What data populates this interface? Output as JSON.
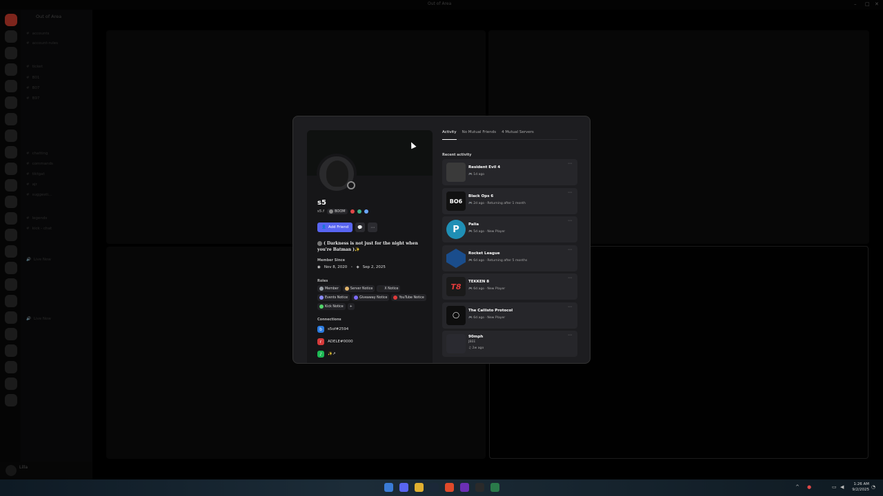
{
  "window": {
    "title": "Out of Area"
  },
  "server": {
    "name": "Out of Area"
  },
  "channels": [
    "accounts",
    "account-rules",
    "ticket",
    "B01",
    "B07",
    "B97",
    "chatting",
    "commands",
    "tiktgat",
    "ajr",
    "suggesti...",
    "legends",
    "kick - chat",
    "Live Now",
    "Live Now"
  ],
  "user_panel": {
    "name": "Lilla"
  },
  "profile": {
    "display_name": "s5",
    "username": "s5.f",
    "guild_tag": "BOOM",
    "add_friend_label": "Add Friend",
    "bio": "( Darkness is not just for the night when you're Batman )✨",
    "member_since_label": "Member Since",
    "member_since_discord": "Nov 8, 2020",
    "member_since_server": "Sep 2, 2025",
    "roles_label": "Roles",
    "roles": [
      {
        "name": "Member",
        "color": "#9aa0a6"
      },
      {
        "name": "Server Notice",
        "color": "#e0b36a"
      },
      {
        "name": "X Notice",
        "color": "#222222"
      },
      {
        "name": "Events Notice",
        "color": "#8b8bff"
      },
      {
        "name": "Giveaway Notice",
        "color": "#7d6bff"
      },
      {
        "name": "YouTube Notice",
        "color": "#e03b3b"
      },
      {
        "name": "Kick Notice",
        "color": "#53d56b"
      }
    ],
    "connections_label": "Connections",
    "connections": [
      {
        "name": "s5of#2594",
        "icon": "battlenet-icon",
        "color": "#2b7be0"
      },
      {
        "name": "ADELE#0000",
        "icon": "riot-icon",
        "color": "#d63a3a"
      },
      {
        "name": "✨↗",
        "icon": "spotify-icon",
        "color": "#1db954"
      }
    ]
  },
  "tabs": [
    {
      "label": "Activity"
    },
    {
      "label": "No Mutual Friends"
    },
    {
      "label": "4 Mutual Servers"
    }
  ],
  "recent_activity_label": "Recent activity",
  "activities": [
    {
      "name": "Resident Evil 4",
      "meta": "1d ago",
      "thumb": "",
      "color": "#3a3a3a"
    },
    {
      "name": "Black Ops 6",
      "meta": "2d ago  ·  Returning after 1 month",
      "thumb": "BO6",
      "color": "#111111"
    },
    {
      "name": "Palia",
      "meta": "5d ago  ·  New Player",
      "thumb": "P",
      "color": "#1f8fb5"
    },
    {
      "name": "Rocket League",
      "meta": "6d ago  ·  Returning after 5 months",
      "thumb": "",
      "color": "#1a4d8c"
    },
    {
      "name": "TEKKEN 8",
      "meta": "6d ago  ·  New Player",
      "thumb": "T8",
      "color": "#1a1a1a"
    },
    {
      "name": "The Callisto Protocol",
      "meta": "6d ago  ·  New Player",
      "thumb": "◯",
      "color": "#0e0e0e"
    },
    {
      "name": "90mph",
      "meta": "JBEE",
      "meta2": "2w ago",
      "thumb": "",
      "color": "#2a2a30"
    }
  ],
  "taskbar": {
    "time": "1:26 AM",
    "date": "9/2/2025"
  },
  "colors": {
    "accent": "#5865f2",
    "modal_bg": "#1d1d20",
    "card_bg": "#26262a"
  }
}
